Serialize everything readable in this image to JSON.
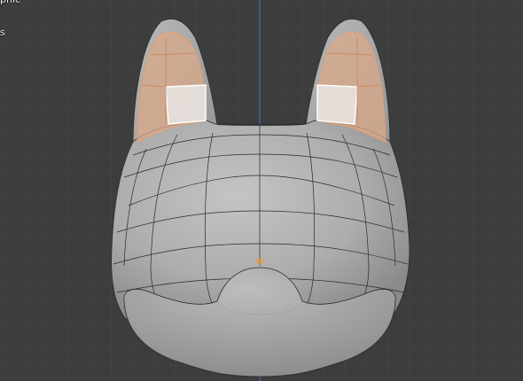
{
  "viewport": {
    "view_name": "phic",
    "collection_name": "s",
    "background_color": "#3d3d3d",
    "grid_color": "#474747",
    "axis_color": "#3b6fbf",
    "mesh_color": "#b5b5b5",
    "wire_color": "#2a2a2a",
    "selection_color": "#e8a070",
    "origin_color": "#ff9a1f"
  },
  "mesh": {
    "object": "cat-head",
    "selected_faces": "ears-inner"
  }
}
